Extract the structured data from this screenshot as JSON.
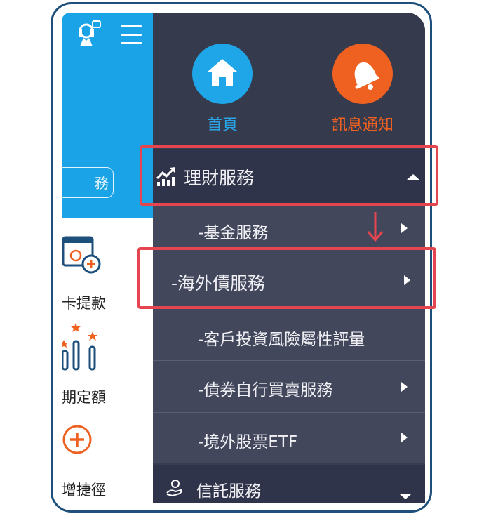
{
  "left_panel": {
    "search_text": "務",
    "items": [
      {
        "label": "卡提款",
        "icon": "atm-card-plus-icon"
      },
      {
        "label": "期定額",
        "icon": "stars-bar-chart-icon"
      },
      {
        "label": "增捷徑",
        "icon": "add-shortcut-icon"
      }
    ]
  },
  "drawer": {
    "shortcuts": [
      {
        "label": "首頁",
        "icon": "home-icon",
        "color": "#1fa6e8"
      },
      {
        "label": "訊息通知",
        "icon": "bell-icon",
        "color": "#ef6121"
      }
    ],
    "section_wealth": {
      "label": "理財服務",
      "icon": "growth-chart-icon"
    },
    "sub_items": [
      {
        "label": "-基金服務"
      },
      {
        "label": "-海外債服務"
      },
      {
        "label": "-客戶投資風險屬性評量"
      },
      {
        "label": "-債券自行買賣服務"
      },
      {
        "label": "-境外股票ETF"
      }
    ],
    "section_trust": {
      "label": "信託服務",
      "icon": "trust-hand-icon"
    }
  },
  "colors": {
    "highlight": "#e5454f",
    "drawer_bg": "#383c4f",
    "app_blue": "#1aa3e6"
  }
}
